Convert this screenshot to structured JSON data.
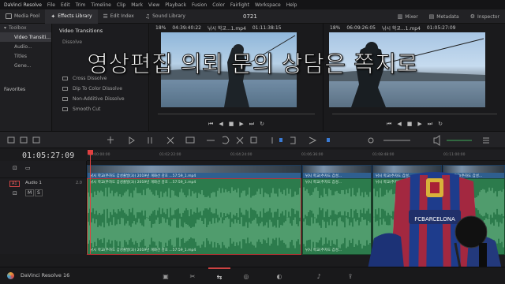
{
  "menubar": {
    "app_name": "DaVinci Resolve",
    "items": [
      "File",
      "Edit",
      "Trim",
      "Timeline",
      "Clip",
      "Mark",
      "View",
      "Playback",
      "Fusion",
      "Color",
      "Fairlight",
      "Workspace",
      "Help"
    ]
  },
  "toolbar": {
    "media_pool": "Media Pool",
    "effects_library": "Effects Library",
    "edit_index": "Edit Index",
    "sound_library": "Sound Library",
    "project_title": "0721",
    "mixer": "Mixer",
    "metadata": "Metadata",
    "inspector": "Inspector"
  },
  "left_panel": {
    "header": "Toolbox",
    "items": [
      "Video Transiti...",
      "Audio...",
      "Titles",
      "Gene..."
    ],
    "favorites": "Favorites"
  },
  "effects": {
    "header": "Video Transitions",
    "category": "Dissolve",
    "items": [
      "Cross Dissolve",
      "Dip To Color Dissolve",
      "Non-Additive Dissolve",
      "Smooth Cut"
    ]
  },
  "viewer_left": {
    "zoom": "18%",
    "timecode": "04:39:40:22",
    "clip_name": "낚시 학교...1.mp4",
    "duration": "01:11:38:15"
  },
  "viewer_right": {
    "zoom": "18%",
    "timecode": "06:09:26:05",
    "clip_name": "낚시 학교...1.mp4",
    "duration": "01:05:27:09"
  },
  "timeline": {
    "current_timecode": "01:05:27:09",
    "ruler_marks": [
      "01:00:00:00",
      "01:02:22:00",
      "01:04:24:00",
      "01:06:36:00",
      "01:08:48:00",
      "01:11:00:00"
    ],
    "audio_track_label": "Audio 1",
    "audio_track_id": "A1",
    "audio_track_gain": "2.0",
    "clip_text": "낚시 학교(추자도 갑성출발(3)) 2019년 개화산 감호 ...57:59_1.mp4",
    "clip_text_short": "낚시 학교(추자도 갑성..."
  },
  "overlay_caption": "영상편집 의뢰 문의 상담은 쪽지로",
  "bottombar": {
    "app_label": "DaVinci Resolve 16"
  },
  "chair_text": "FCBARCELONA",
  "colors": {
    "video_clip": "#2f5f8f",
    "audio_clip": "#2c7b4c",
    "playhead": "#e04040"
  }
}
